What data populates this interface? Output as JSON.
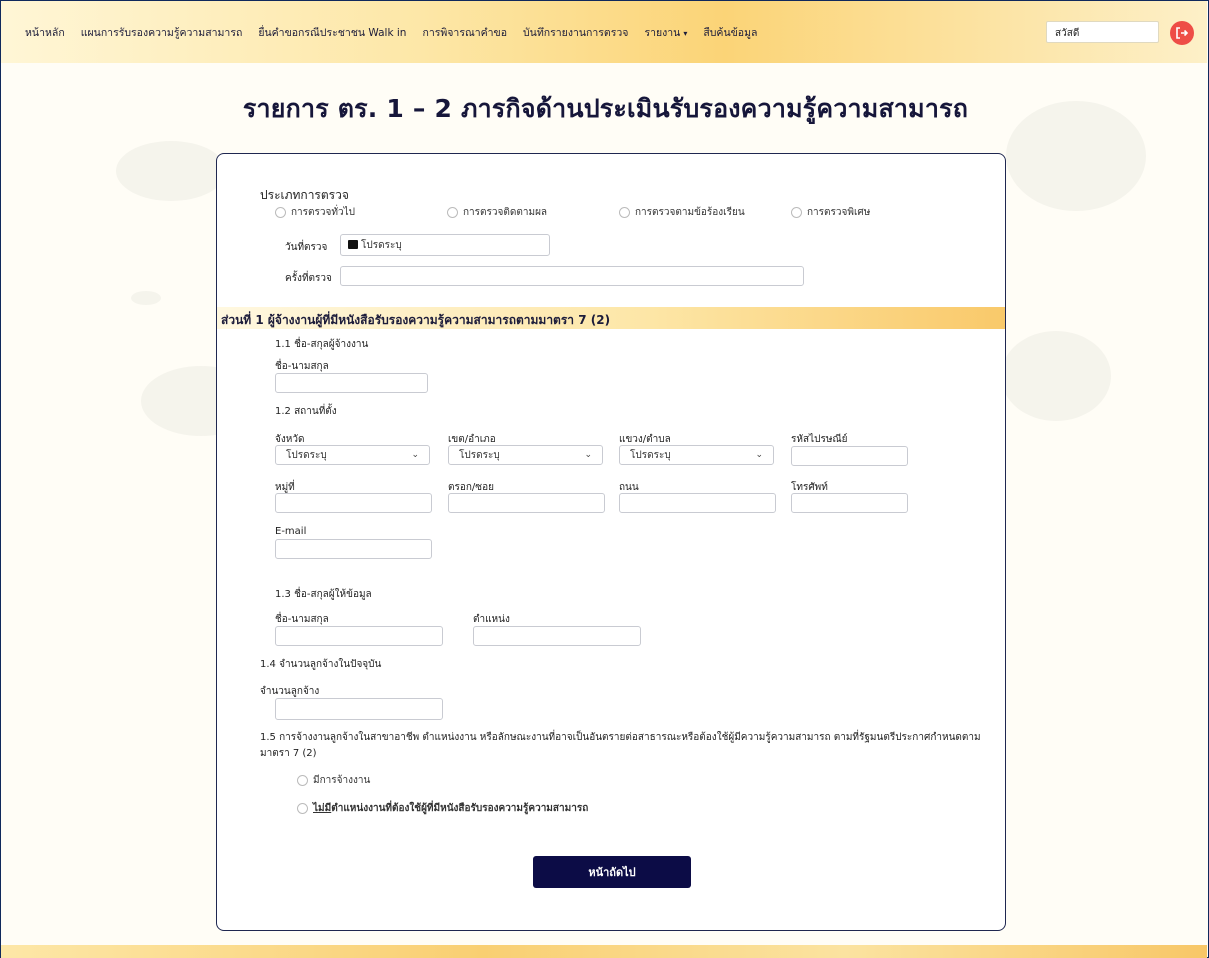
{
  "nav": {
    "items": [
      "หน้าหลัก",
      "แผนการรับรองความรู้ความสามารถ",
      "ยื่นคำขอกรณีประชาชน Walk in",
      "การพิจารณาคำขอ",
      "บันทึกรายงานการตรวจ",
      "รายงาน",
      "สืบค้นข้อมูล"
    ],
    "caret": "▾",
    "greeting": "สวัสดี",
    "logout_icon": "logout-icon"
  },
  "title": "รายการ ตร. 1 – 2 ภารกิจด้านประเมินรับรองความรู้ความสามารถ",
  "inspection": {
    "heading": "ประเภทการตรวจ",
    "types": [
      "การตรวจทั่วไป",
      "การตรวจติดตามผล",
      "การตรวจตามข้อร้องเรียน",
      "การตรวจพิเศษ"
    ],
    "date_label": "วันที่ตรวจ",
    "date_placeholder": "โปรดระบุ",
    "count_label": "ครั้งที่ตรวจ",
    "count_value": ""
  },
  "section1": {
    "title": "ส่วนที่ 1 ผู้จ้างงานผู้ที่มีหนังสือรับรองความรู้ความสามารถตามมาตรา 7 (2)",
    "s11": {
      "heading": "1.1 ชื่อ-สกุลผู้จ้างงาน",
      "name_label": "ชื่อ-นามสกุล"
    },
    "s12": {
      "heading": "1.2 สถานที่ตั้ง",
      "province_label": "จังหวัด",
      "province_value": "โปรดระบุ",
      "district_label": "เขต/อำเภอ",
      "district_value": "โปรดระบุ",
      "subdistrict_label": "แขวง/ตำบล",
      "subdistrict_value": "โปรดระบุ",
      "zip_label": "รหัสไปรษณีย์",
      "moo_label": "หมู่ที่",
      "soi_label": "ตรอก/ซอย",
      "road_label": "ถนน",
      "phone_label": "โทรศัพท์",
      "email_label": "E-mail"
    },
    "s13": {
      "heading": "1.3 ชื่อ-สกุลผู้ให้ข้อมูล",
      "name_label": "ชื่อ-นามสกุล",
      "position_label": "ตำแหน่ง"
    },
    "s14": {
      "heading": "1.4 จำนวนลูกจ้างในปัจจุบัน",
      "count_label": "จำนวนลูกจ้าง"
    },
    "s15": {
      "text_line1": "1.5 การจ้างงานลูกจ้างในสาขาอาชีพ ตำแหน่งงาน หรือลักษณะงานที่อาจเป็นอันตรายต่อสาธารณะหรือต้องใช้ผู้มีความรู้ความสามารถ ตามที่รัฐมนตรีประกาศกำหนดตาม",
      "text_line2": "มาตรา 7 (2)",
      "option_yes": "มีการจ้างงาน",
      "option_no_prefix": "ไม่มี",
      "option_no_rest": "ตำแหน่งงานที่ต้องใช้ผู้ที่มีหนังสือรับรองความรู้ความสามารถ"
    }
  },
  "next_button": "หน้าถัดไป",
  "colors": {
    "navy": "#0c0c46",
    "logout": "#ee4d46",
    "gold": "#f9c96a"
  }
}
